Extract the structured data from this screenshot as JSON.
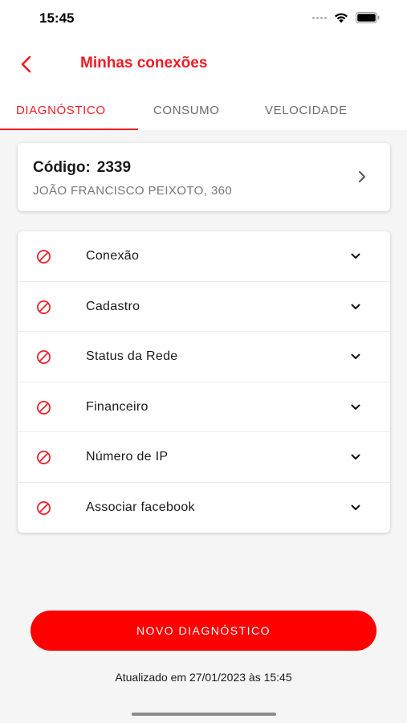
{
  "status_bar": {
    "time": "15:45"
  },
  "header": {
    "title": "Minhas conexões"
  },
  "tabs": [
    {
      "label": "DIAGNÓSTICO",
      "active": true
    },
    {
      "label": "CONSUMO",
      "active": false
    },
    {
      "label": "VELOCIDADE",
      "active": false
    }
  ],
  "connection": {
    "code_label": "Código:",
    "code_value": "2339",
    "address": "JOÃO FRANCISCO PEIXOTO, 360"
  },
  "diagnostics": [
    {
      "label": "Conexão"
    },
    {
      "label": "Cadastro"
    },
    {
      "label": "Status da Rede"
    },
    {
      "label": "Financeiro"
    },
    {
      "label": "Número de IP"
    },
    {
      "label": "Associar facebook"
    }
  ],
  "actions": {
    "new_diagnostic_label": "NOVO DIAGNÓSTICO"
  },
  "footer": {
    "updated_text": "Atualizado em 27/01/2023 às 15:45"
  },
  "colors": {
    "accent": "#ee1c25",
    "button": "#ff0000",
    "background": "#f5f5f5"
  }
}
